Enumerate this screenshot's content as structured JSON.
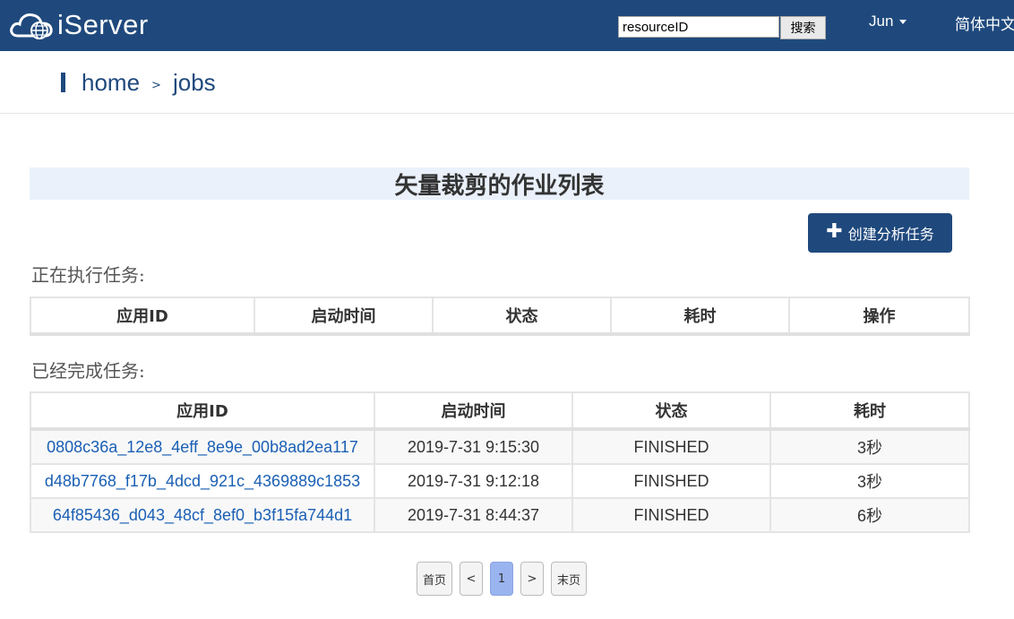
{
  "header": {
    "logo_text": "iServer",
    "search": {
      "value": "resourceID",
      "button_label": "搜索"
    },
    "user": "Jun",
    "language": "简体中文"
  },
  "breadcrumb": {
    "home": "home",
    "separator": ">",
    "current": "jobs"
  },
  "page_title": "矢量裁剪的作业列表",
  "create_button": {
    "icon": "plus-icon",
    "label": "创建分析任务"
  },
  "running": {
    "label": "正在执行任务:",
    "columns": [
      "应用ID",
      "启动时间",
      "状态",
      "耗时",
      "操作"
    ]
  },
  "finished": {
    "label": "已经完成任务:",
    "columns": [
      "应用ID",
      "启动时间",
      "状态",
      "耗时"
    ],
    "rows": [
      {
        "id": "0808c36a_12e8_4eff_8e9e_00b8ad2ea117",
        "start": "2019-7-31 9:15:30",
        "status": "FINISHED",
        "duration": "3秒"
      },
      {
        "id": "d48b7768_f17b_4dcd_921c_4369889c1853",
        "start": "2019-7-31 9:12:18",
        "status": "FINISHED",
        "duration": "3秒"
      },
      {
        "id": "64f85436_d043_48cf_8ef0_b3f15fa744d1",
        "start": "2019-7-31 8:44:37",
        "status": "FINISHED",
        "duration": "6秒"
      }
    ]
  },
  "pagination": {
    "first": "首页",
    "prev": "<",
    "current": "1",
    "next": ">",
    "last": "末页"
  },
  "colors": {
    "header_bg": "#1f497d",
    "link": "#1a5fb4",
    "active_page": "#9ab4f0",
    "title_band": "#eaf1fb"
  }
}
